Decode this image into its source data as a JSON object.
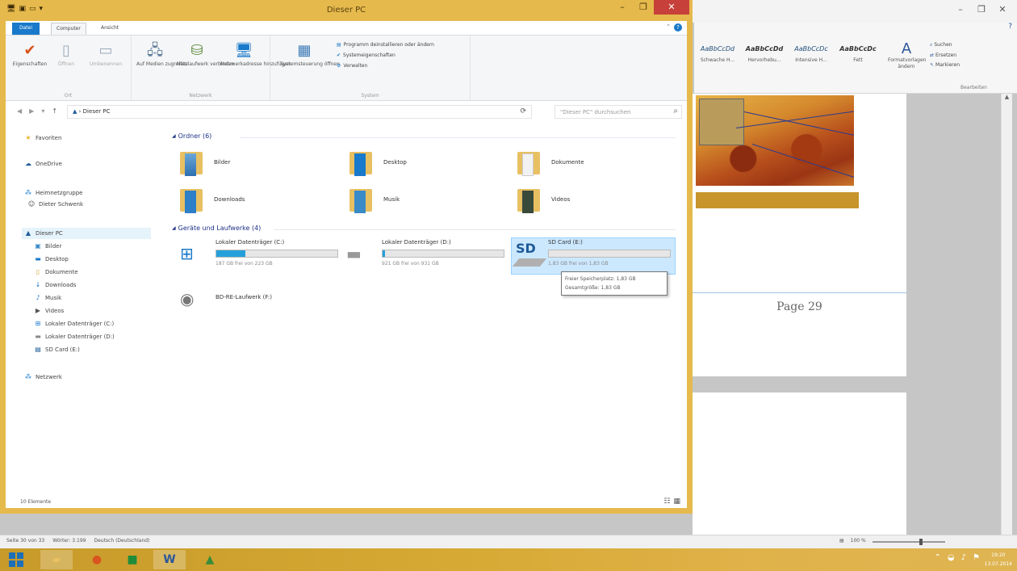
{
  "explorer": {
    "title": "Dieser PC",
    "tabs": {
      "file": "Datei",
      "computer": "Computer",
      "view": "Ansicht"
    },
    "ribbon": {
      "properties": "Eigenschaften",
      "open": "Öffnen",
      "rename": "Umbenennen",
      "group_location": "Ort",
      "access_media": "Auf Medien zugreifen",
      "map_drive": "Netzlaufwerk verbinden",
      "add_network_location": "Netzwerkadresse hinzufügen",
      "group_network": "Netzwerk",
      "open_settings": "Systemsteuerung öffnen",
      "uninstall": "Programm deinstallieren oder ändern",
      "system_properties": "Systemeigenschaften",
      "manage": "Verwalten",
      "group_system": "System"
    },
    "address": {
      "path": "Dieser PC",
      "search_placeholder": "\"Dieser PC\" durchsuchen"
    },
    "nav": {
      "favorites": "Favoriten",
      "onedrive": "OneDrive",
      "homegroup": "Heimnetzgruppe",
      "user": "Dieter Schwenk",
      "this_pc": "Dieser PC",
      "pictures": "Bilder",
      "desktop": "Desktop",
      "documents": "Dokumente",
      "downloads": "Downloads",
      "music": "Musik",
      "videos": "Videos",
      "drive_c": "Lokaler Datenträger (C:)",
      "drive_d": "Lokaler Datenträger (D:)",
      "sd_card": "SD Card (E:)",
      "network": "Netzwerk"
    },
    "folders_header": "Ordner (6)",
    "folders": [
      "Bilder",
      "Desktop",
      "Dokumente",
      "Downloads",
      "Musik",
      "Videos"
    ],
    "drives_header": "Geräte und Laufwerke (4)",
    "drives": [
      {
        "name": "Lokaler Datenträger (C:)",
        "free": "187 GB frei von 223 GB",
        "used_fraction": 0.24
      },
      {
        "name": "Lokaler Datenträger (D:)",
        "free": "921 GB frei von 931 GB",
        "used_fraction": 0.02
      },
      {
        "name": "SD Card (E:)",
        "free": "1,83 GB frei von 1,83 GB",
        "used_fraction": 0.0
      },
      {
        "name": "BD-RE-Laufwerk (F:)"
      }
    ],
    "sd_label": "SD",
    "tooltip": {
      "free_space": "Freier Speicherplatz: 1,83 GB",
      "total_size": "Gesamtgröße: 1,83 GB"
    },
    "status_count": "10 Elemente"
  },
  "word": {
    "styles": [
      {
        "sample": "AaBbCcDd",
        "name": "Schwache H..."
      },
      {
        "sample": "AaBbCcDd",
        "name": "Hervorhebu..."
      },
      {
        "sample": "AaBbCcDc",
        "name": "Intensive H..."
      },
      {
        "sample": "AaBbCcDc",
        "name": "Fett"
      }
    ],
    "format_templates": "Formatvorlagen ändern",
    "search": "Suchen",
    "replace": "Ersetzen",
    "select": "Markieren",
    "edit_group": "Bearbeiten",
    "page_label": "Page 29",
    "status": {
      "page": "Seite 30 von 33",
      "words": "Wörter: 3.199",
      "language": "Deutsch (Deutschland)",
      "zoom": "100 %"
    }
  },
  "taskbar": {
    "time": "19:20",
    "date": "13.07.2014"
  },
  "colors": {
    "explorer_frame": "#e5b94c",
    "close_button": "#c7413a",
    "accent_blue": "#1979ca",
    "selection": "#cce8ff"
  }
}
